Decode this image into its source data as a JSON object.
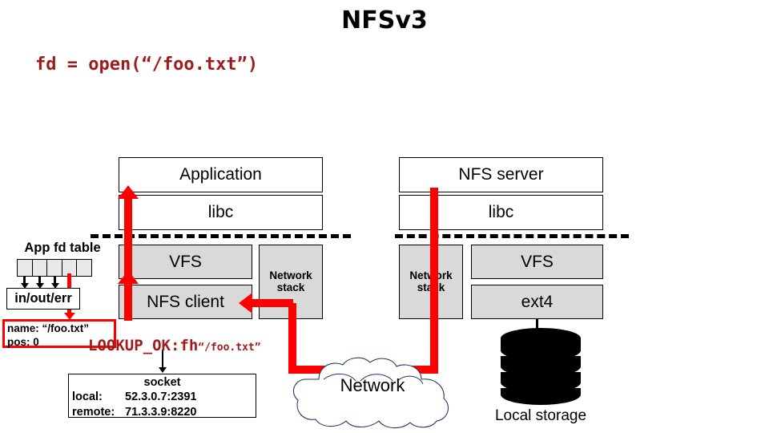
{
  "slide": {
    "title": "NFSv3",
    "code_line": "fd = open(“/foo.txt”)"
  },
  "client_stack": {
    "application": "Application",
    "libc": "libc",
    "vfs": "VFS",
    "nfs_client": "NFS client",
    "network_stack_line1": "Network",
    "network_stack_line2": "stack"
  },
  "server_stack": {
    "nfs_server": "NFS server",
    "libc": "libc",
    "vfs": "VFS",
    "ext4": "ext4",
    "network_stack_line1": "Network",
    "network_stack_line2": "stack"
  },
  "fd_table": {
    "label": "App fd table",
    "cells": [
      "",
      "",
      "",
      "",
      ""
    ],
    "std_streams": "in/out/err"
  },
  "file_object": {
    "name_line": "name: “/foo.txt”",
    "pos_line": "pos: 0",
    "border_color": "#ff0000"
  },
  "socket": {
    "title": "socket",
    "local_key": "local:",
    "local_value": "52.3.0.7:2391",
    "remote_key": "remote:",
    "remote_value": "71.3.3.9:8220"
  },
  "rpc_message": {
    "call": "LOOKUP_OK:fh",
    "subscript": "“/foo.txt”",
    "color": "#9e1b1b"
  },
  "network": {
    "cloud_label": "Network"
  },
  "storage": {
    "label": "Local storage"
  },
  "colors": {
    "flow_red": "#ff0000",
    "box_gray": "#d9d9d9",
    "box_white": "#ffffff",
    "outline_black": "#000000",
    "code_red": "#9e1b1b"
  }
}
